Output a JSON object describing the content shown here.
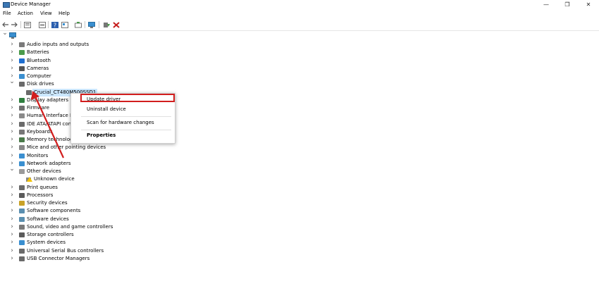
{
  "window": {
    "title": "Device Manager",
    "app_icon": "device-manager-icon"
  },
  "window_controls": {
    "minimize": "—",
    "maximize": "❐",
    "close": "✕"
  },
  "menu": [
    "File",
    "Action",
    "View",
    "Help"
  ],
  "toolbar": [
    "back-arrow",
    "forward-arrow",
    "properties",
    "show-hidden",
    "help",
    "view",
    "scan",
    "monitor",
    "update-driver",
    "uninstall"
  ],
  "tree": {
    "root_chevron": "⌄",
    "items": [
      {
        "label": "Audio inputs and outputs",
        "expanded": false,
        "icon": "speaker-icon",
        "color": "#7a7a7a"
      },
      {
        "label": "Batteries",
        "expanded": false,
        "icon": "battery-icon",
        "color": "#4b9b4b"
      },
      {
        "label": "Bluetooth",
        "expanded": false,
        "icon": "bluetooth-icon",
        "color": "#1f6fd0"
      },
      {
        "label": "Cameras",
        "expanded": false,
        "icon": "camera-icon",
        "color": "#555555"
      },
      {
        "label": "Computer",
        "expanded": false,
        "icon": "computer-icon",
        "color": "#3a8fd0"
      },
      {
        "label": "Disk drives",
        "expanded": true,
        "icon": "disk-drive-icon",
        "color": "#6a6a6a"
      },
      {
        "label": "Crucial_CT480M500SSD1",
        "child": true,
        "selected": true,
        "icon": "disk-icon",
        "color": "#6a6a6a"
      },
      {
        "label": "Display adapters",
        "expanded": false,
        "icon": "display-adapter-icon",
        "color": "#2f7f3f"
      },
      {
        "label": "Firmware",
        "expanded": false,
        "icon": "firmware-icon",
        "color": "#707070"
      },
      {
        "label": "Human Interface Devices",
        "expanded": false,
        "icon": "hid-icon",
        "color": "#8a8a8a"
      },
      {
        "label": "IDE ATA/ATAPI controllers",
        "expanded": false,
        "icon": "ide-icon",
        "color": "#6a6a6a"
      },
      {
        "label": "Keyboards",
        "expanded": false,
        "icon": "keyboard-icon",
        "color": "#777777"
      },
      {
        "label": "Memory technology devices",
        "expanded": false,
        "icon": "memory-icon",
        "color": "#4a7a4a"
      },
      {
        "label": "Mice and other pointing devices",
        "expanded": false,
        "icon": "mouse-icon",
        "color": "#888888"
      },
      {
        "label": "Monitors",
        "expanded": false,
        "icon": "monitor-icon",
        "color": "#3a8fd0"
      },
      {
        "label": "Network adapters",
        "expanded": false,
        "icon": "network-icon",
        "color": "#3a8fd0"
      },
      {
        "label": "Other devices",
        "expanded": true,
        "icon": "other-devices-icon",
        "color": "#9a9a9a"
      },
      {
        "label": "Unknown device",
        "child": true,
        "icon": "unknown-device-icon",
        "color": "#c9a227"
      },
      {
        "label": "Print queues",
        "expanded": false,
        "icon": "printer-icon",
        "color": "#6a6a6a"
      },
      {
        "label": "Processors",
        "expanded": false,
        "icon": "processor-icon",
        "color": "#5a5a5a"
      },
      {
        "label": "Security devices",
        "expanded": false,
        "icon": "security-icon",
        "color": "#c9a227"
      },
      {
        "label": "Software components",
        "expanded": false,
        "icon": "software-component-icon",
        "color": "#5a8fb0"
      },
      {
        "label": "Software devices",
        "expanded": false,
        "icon": "software-device-icon",
        "color": "#5a8fb0"
      },
      {
        "label": "Sound, video and game controllers",
        "expanded": false,
        "icon": "sound-icon",
        "color": "#7a7a7a"
      },
      {
        "label": "Storage controllers",
        "expanded": false,
        "icon": "storage-icon",
        "color": "#5a5a5a"
      },
      {
        "label": "System devices",
        "expanded": false,
        "icon": "system-device-icon",
        "color": "#3a8fd0"
      },
      {
        "label": "Universal Serial Bus controllers",
        "expanded": false,
        "icon": "usb-icon",
        "color": "#6a6a6a"
      },
      {
        "label": "USB Connector Managers",
        "expanded": false,
        "icon": "usb-connector-icon",
        "color": "#6a6a6a"
      }
    ]
  },
  "context_menu": {
    "items": [
      "Update driver",
      "Uninstall device",
      "Scan for hardware changes",
      "Properties"
    ],
    "highlighted": "Update driver"
  },
  "colors": {
    "highlight": "#d21e1e",
    "selection": "#cce8ff"
  }
}
